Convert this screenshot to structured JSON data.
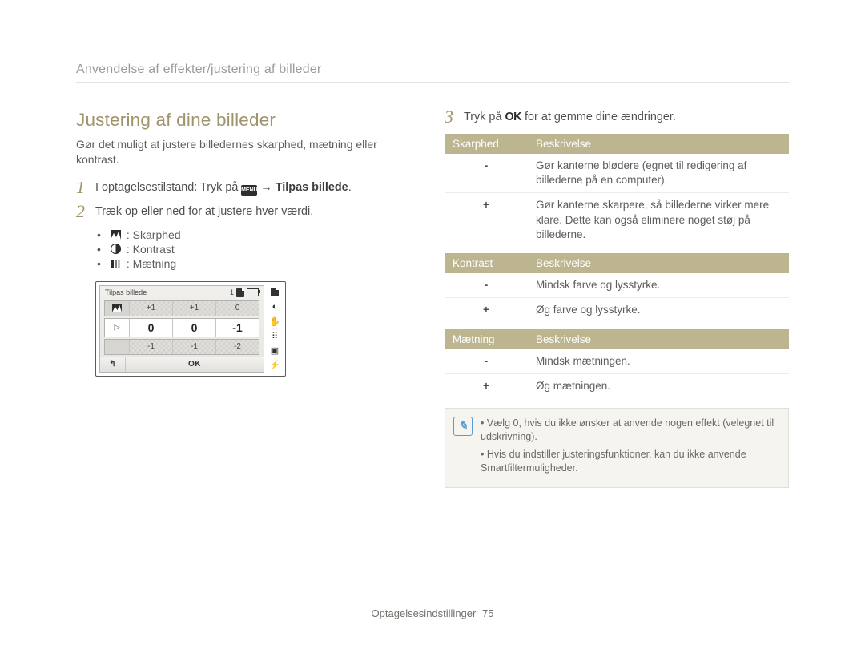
{
  "header": "Anvendelse af effekter/justering af billeder",
  "section_title": "Justering af dine billeder",
  "intro": "Gør det muligt at justere billedernes skarphed, mætning eller kontrast.",
  "steps": {
    "s1_a": "I optagelsestilstand: Tryk på ",
    "s1_menu": "MENU",
    "s1_arrow": " → ",
    "s1_b": "Tilpas billede",
    "s2": "Træk op eller ned for at justere hver værdi.",
    "sub": {
      "a": ": Skarphed",
      "b": ": Kontrast",
      "c": ": Mætning"
    },
    "s3_a": "Tryk på ",
    "s3_ok": "OK",
    "s3_b": " for at gemme dine ændringer."
  },
  "camera": {
    "title": "Tilpas billede",
    "count": "1",
    "rows": {
      "top": [
        "+1",
        "+1",
        "0"
      ],
      "mid": [
        "0",
        "0",
        "-1"
      ],
      "bot": [
        "-1",
        "-1",
        "-2"
      ]
    },
    "back_glyph": "↰",
    "ok": "OK",
    "side_icons": [
      "sd-icon",
      "circle-icon",
      "palm-icon",
      "grip-icon",
      "frame-icon",
      "flash-icon"
    ]
  },
  "tables": {
    "t1": {
      "h1": "Skarphed",
      "h2": "Beskrivelse",
      "rows": [
        {
          "k": "-",
          "v": "Gør kanterne blødere (egnet til redigering af billederne på en computer)."
        },
        {
          "k": "+",
          "v": "Gør kanterne skarpere, så billederne virker mere klare. Dette kan også eliminere noget støj på billederne."
        }
      ]
    },
    "t2": {
      "h1": "Kontrast",
      "h2": "Beskrivelse",
      "rows": [
        {
          "k": "-",
          "v": "Mindsk farve og lysstyrke."
        },
        {
          "k": "+",
          "v": "Øg farve og lysstyrke."
        }
      ]
    },
    "t3": {
      "h1": "Mætning",
      "h2": "Beskrivelse",
      "rows": [
        {
          "k": "-",
          "v": "Mindsk mætningen."
        },
        {
          "k": "+",
          "v": "Øg mætningen."
        }
      ]
    }
  },
  "notes": {
    "a": "Vælg 0, hvis du ikke ønsker at anvende nogen effekt (velegnet til udskrivning).",
    "b": "Hvis du indstiller justeringsfunktioner, kan du ikke anvende Smartfiltermuligheder."
  },
  "footer": {
    "label": "Optagelsesindstillinger",
    "page": "75"
  }
}
